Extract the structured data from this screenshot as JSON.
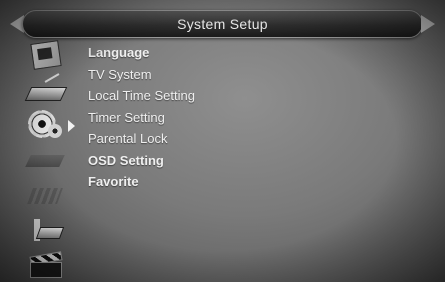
{
  "header": {
    "title": "System Setup",
    "left_arrow_icon": "arrow-left-icon",
    "right_arrow_icon": "arrow-right-icon"
  },
  "sidebar": {
    "icons": [
      {
        "name": "language-icon"
      },
      {
        "name": "tv-system-icon"
      },
      {
        "name": "settings-gear-icon",
        "selected": true
      },
      {
        "name": "timer-icon"
      },
      {
        "name": "parental-lock-icon"
      },
      {
        "name": "osd-icon"
      },
      {
        "name": "favorite-clapperboard-icon"
      }
    ]
  },
  "menu": {
    "items": [
      {
        "label": "Language"
      },
      {
        "label": "TV System"
      },
      {
        "label": "Local Time Setting"
      },
      {
        "label": "Timer Setting"
      },
      {
        "label": "Parental Lock"
      },
      {
        "label": "OSD Setting"
      },
      {
        "label": "Favorite"
      }
    ]
  },
  "colors": {
    "text": "#efefef",
    "title_bar": "#2f2f2f",
    "background": "#7a7a7a"
  }
}
